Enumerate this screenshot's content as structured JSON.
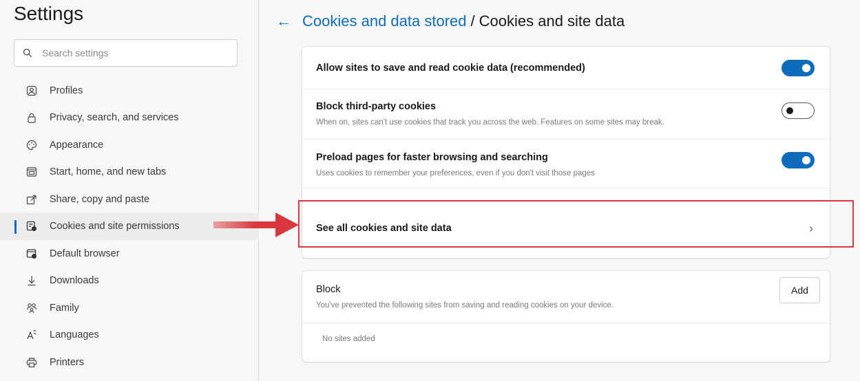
{
  "sidebar": {
    "title": "Settings",
    "search_placeholder": "Search settings",
    "items": [
      {
        "label": "Profiles",
        "icon": "profile-icon"
      },
      {
        "label": "Privacy, search, and services",
        "icon": "lock-icon"
      },
      {
        "label": "Appearance",
        "icon": "palette-icon"
      },
      {
        "label": "Start, home, and new tabs",
        "icon": "home-tab-icon"
      },
      {
        "label": "Share, copy and paste",
        "icon": "share-icon"
      },
      {
        "label": "Cookies and site permissions",
        "icon": "cookies-icon",
        "active": true
      },
      {
        "label": "Default browser",
        "icon": "browser-icon"
      },
      {
        "label": "Downloads",
        "icon": "download-icon"
      },
      {
        "label": "Family",
        "icon": "family-icon"
      },
      {
        "label": "Languages",
        "icon": "languages-icon"
      },
      {
        "label": "Printers",
        "icon": "printer-icon"
      }
    ]
  },
  "header": {
    "back_icon": "back-arrow-icon",
    "breadcrumb_link": "Cookies and data stored",
    "separator": "/",
    "current": "Cookies and site data"
  },
  "settings": {
    "allow": {
      "title": "Allow sites to save and read cookie data (recommended)",
      "enabled": true
    },
    "block_third_party": {
      "title": "Block third-party cookies",
      "desc": "When on, sites can't use cookies that track you across the web. Features on some sites may break.",
      "enabled": false
    },
    "preload": {
      "title": "Preload pages for faster browsing and searching",
      "desc": "Uses cookies to remember your preferences, even if you don't visit those pages",
      "enabled": true
    },
    "see_all": {
      "title": "See all cookies and site data",
      "chevron": "›"
    }
  },
  "block": {
    "title": "Block",
    "desc": "You've prevented the following sites from saving and reading cookies on your device.",
    "add_label": "Add",
    "empty_text": "No sites added"
  },
  "colors": {
    "accent": "#0f6cbd",
    "highlight": "#d9363e"
  }
}
